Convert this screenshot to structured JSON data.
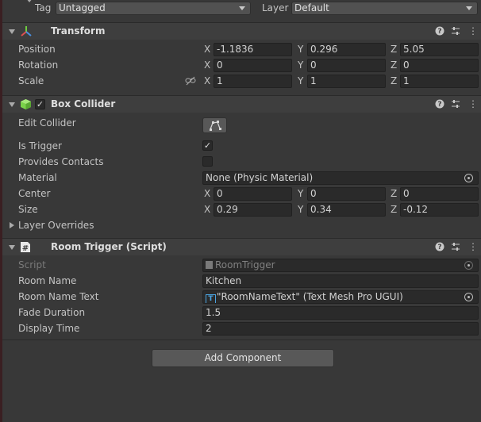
{
  "top": {
    "tag_label": "Tag",
    "tag_value": "Untagged",
    "layer_label": "Layer",
    "layer_value": "Default"
  },
  "transform": {
    "title": "Transform",
    "position": {
      "label": "Position",
      "x": "-1.1836",
      "y": "0.296",
      "z": "5.05"
    },
    "rotation": {
      "label": "Rotation",
      "x": "0",
      "y": "0",
      "z": "0"
    },
    "scale": {
      "label": "Scale",
      "x": "1",
      "y": "1",
      "z": "1"
    }
  },
  "axes": {
    "x": "X",
    "y": "Y",
    "z": "Z"
  },
  "box_collider": {
    "title": "Box Collider",
    "enabled": true,
    "edit_collider": "Edit Collider",
    "is_trigger_label": "Is Trigger",
    "is_trigger": true,
    "provides_contacts_label": "Provides Contacts",
    "provides_contacts": false,
    "material_label": "Material",
    "material_value": "None (Physic Material)",
    "center": {
      "label": "Center",
      "x": "0",
      "y": "0",
      "z": "0"
    },
    "size": {
      "label": "Size",
      "x": "0.29",
      "y": "0.34",
      "z": "-0.12"
    },
    "layer_overrides": "Layer Overrides"
  },
  "room_trigger": {
    "title": "Room Trigger (Script)",
    "script_label": "Script",
    "script_value": "RoomTrigger",
    "room_name_label": "Room Name",
    "room_name_value": "Kitchen",
    "room_name_text_label": "Room Name Text",
    "room_name_text_value": "\"RoomNameText\" (Text Mesh Pro UGUI)",
    "fade_duration_label": "Fade Duration",
    "fade_duration_value": "1.5",
    "display_time_label": "Display Time",
    "display_time_value": "2"
  },
  "add_component": "Add Component",
  "icons": {
    "help": "question-circle-icon",
    "presets": "sliders-icon",
    "menu": "kebab-menu-icon"
  },
  "colors": {
    "background": "#383838",
    "field": "#2a2a2a",
    "header": "#3e3e3e",
    "accent_tmp": "#4aa3e0"
  }
}
